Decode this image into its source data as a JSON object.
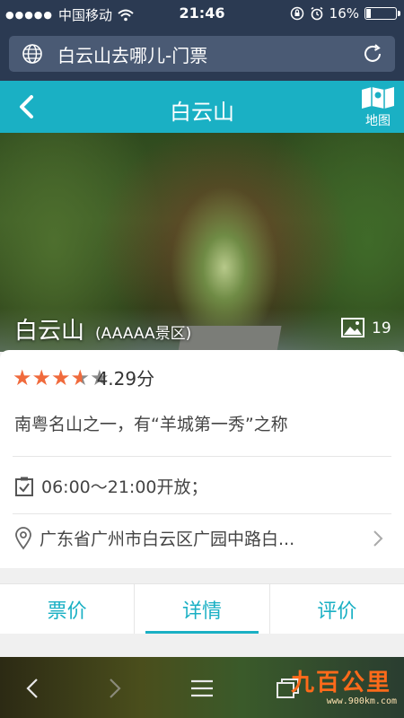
{
  "status_bar": {
    "carrier": "中国移动",
    "time": "21:46",
    "battery": "16%",
    "battery_level": 0.16
  },
  "address_bar": {
    "url_text": "白云山去哪儿-门票"
  },
  "header": {
    "title": "白云山",
    "map_label": "地图"
  },
  "hero": {
    "name": "白云山",
    "level": "(AAAAA景区)",
    "photo_count": "19"
  },
  "info": {
    "rating_value": 4.29,
    "rating_text": "4.29分",
    "description": "南粤名山之一，有“羊城第一秀”之称",
    "hours": "06:00～21:00开放；",
    "address": "广东省广州市白云区广园中路白..."
  },
  "tabs": [
    {
      "label": "票价"
    },
    {
      "label": "详情"
    },
    {
      "label": "评价"
    }
  ],
  "watermark": {
    "logo": "九百公里",
    "url": "www.900km.com"
  },
  "colors": {
    "accent": "#1ab0c4",
    "star": "#f06a3c",
    "status_bg": "#2b3a52"
  }
}
